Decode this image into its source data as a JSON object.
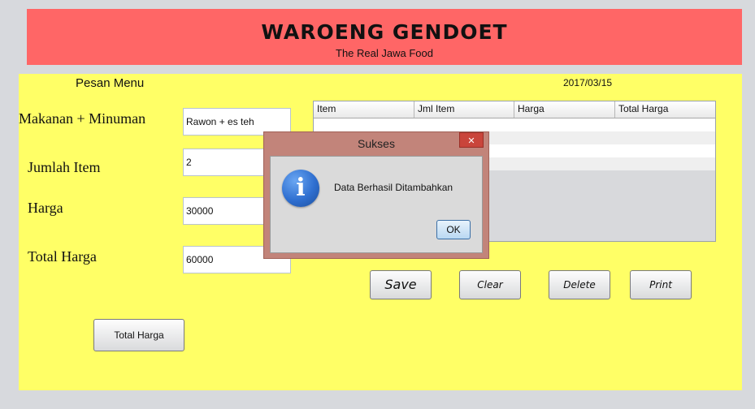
{
  "header": {
    "title": "WAROENG GENDOET",
    "subtitle": "The Real Jawa Food",
    "color": "#ff6666"
  },
  "panel": {
    "section_title": "Pesan Menu",
    "date": "2017/03/15",
    "background": "#ffff66"
  },
  "form": {
    "makanan_label": "Makanan + Minuman",
    "makanan_value": "Rawon + es teh",
    "jumlah_label": "Jumlah Item",
    "jumlah_value": "2",
    "harga_label": "Harga",
    "harga_value": "30000",
    "total_label": "Total Harga",
    "total_value": "60000"
  },
  "table": {
    "columns": [
      "Item",
      "Jml Item",
      "Harga",
      "Total Harga"
    ]
  },
  "buttons": {
    "save": "Save",
    "clear": "Clear",
    "delete": "Delete",
    "print": "Print",
    "total_harga": "Total Harga"
  },
  "dialog": {
    "title": "Sukses",
    "close": "✕",
    "icon": "info-icon",
    "icon_glyph": "i",
    "message": "Data Berhasil Ditambahkan",
    "ok": "OK"
  }
}
